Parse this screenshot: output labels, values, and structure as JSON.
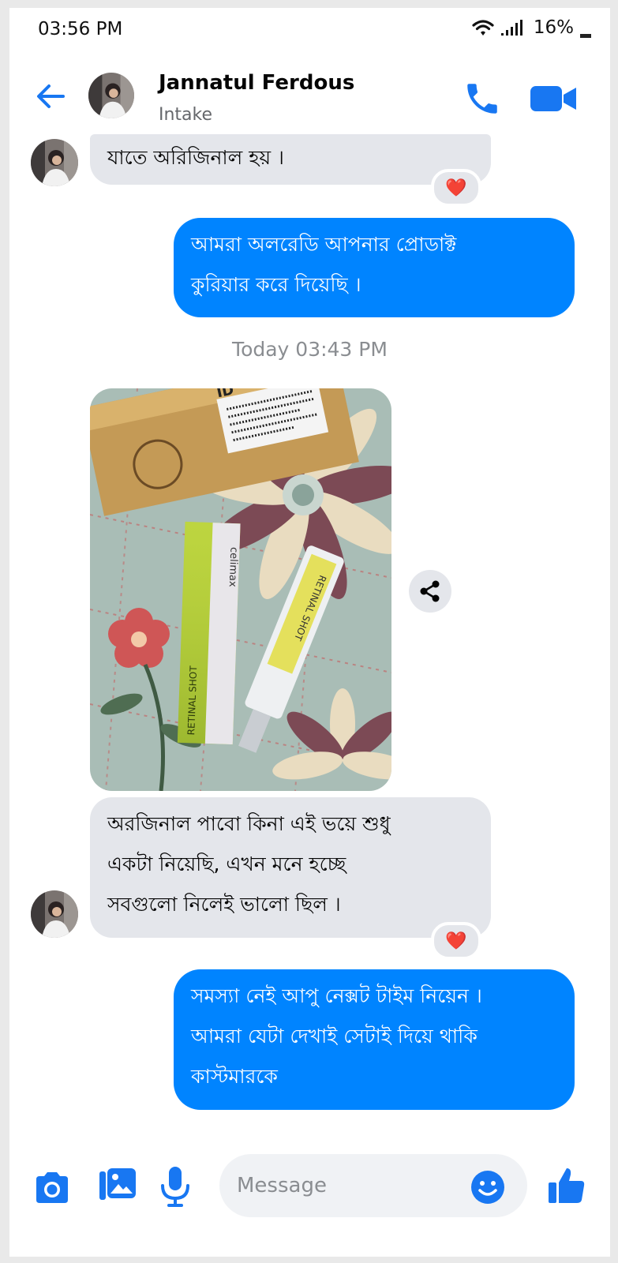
{
  "status_bar": {
    "time": "03:56 PM",
    "battery": "16%"
  },
  "header": {
    "name": "Jannatul Ferdous",
    "subtitle": "Intake"
  },
  "messages": {
    "m1": {
      "lines": [
        "যাতে অরিজিনাল হয় ।"
      ],
      "reaction": "❤️"
    },
    "m2": {
      "lines": [
        "আমরা অলরেডি আপনার প্রোডাক্ট",
        "কুরিয়ার করে দিয়েছি ।"
      ]
    },
    "timestamp": "Today 03:43 PM",
    "m3": {
      "lines": [
        "অরজিনাল পাবো কিনা এই ভয়ে শুধু",
        "একটা নিয়েছি, এখন মনে হচ্ছে",
        "সবগুলো নিলেই ভালো ছিল ।"
      ],
      "reaction": "❤️"
    },
    "m4": {
      "lines": [
        "সমস্যা নেই আপু নেক্সট টাইম নিয়েন ।",
        "আমরা যেটা দেখাই সেটাই দিয়ে থাকি",
        "কাস্টমারকে"
      ]
    }
  },
  "photo": {
    "parcel_label": "ID",
    "box_text_1": "RETINAL SHOT",
    "box_text_2": "celimax",
    "tube_text": "RETINAL SHOT"
  },
  "composer": {
    "placeholder": "Message"
  },
  "colors": {
    "accent": "#0084ff",
    "incoming_bubble": "#e4e6eb",
    "header_icons": "#1877f2"
  }
}
